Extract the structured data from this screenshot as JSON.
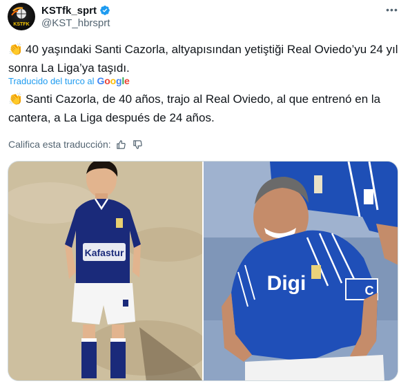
{
  "author": {
    "display_name": "KSTfk_sprt",
    "handle": "@KST_hbrsprt",
    "avatar_text": "KSTFK",
    "verified": true
  },
  "tweet": {
    "original_text": "40 yaşındaki Santi Cazorla, altyapısından yetiştiği Real Oviedo’yu 24 yıl sonra La Liga’ya taşıdı.",
    "emoji": "👏",
    "translation_label": "Traducido del turco al",
    "translation_provider": "Google",
    "translated_text": "Santi Cazorla, de 40 años, trajo al Real Oviedo, al que entrenó en la cantera, a La Liga después de 24 años."
  },
  "rating": {
    "label": "Califica esta traducción:",
    "thumbs_up_icon": "thumbs-up-icon",
    "thumbs_down_icon": "thumbs-down-icon"
  },
  "media": {
    "left_jersey_text": "Kafastur",
    "right_jersey_text": "Digi",
    "captain_text": "C"
  },
  "colors": {
    "link": "#1d9bf0",
    "secondary": "#536471",
    "border": "#cfd9de",
    "oviedo_blue": "#1f4fb8"
  }
}
